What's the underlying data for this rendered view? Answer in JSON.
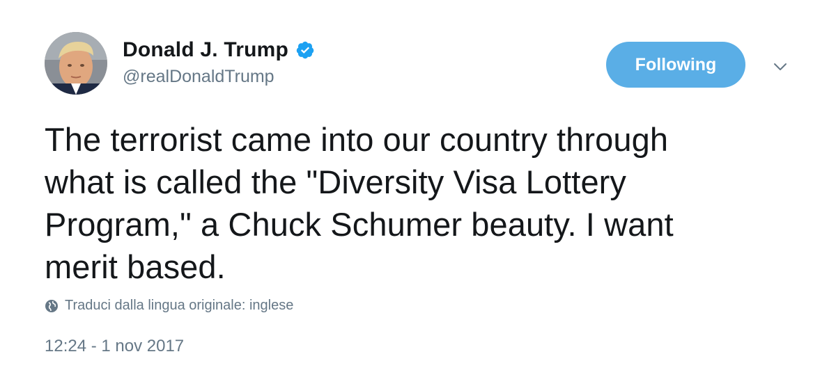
{
  "author": {
    "display_name": "Donald J. Trump",
    "handle": "@realDonaldTrump",
    "verified": true,
    "avatar_icon": "profile-photo"
  },
  "follow_button": {
    "label": "Following",
    "color": "#5aaee6"
  },
  "menu": {
    "icon": "chevron-down-icon"
  },
  "tweet": {
    "lines": [
      "The terrorist came into our country through",
      "what is called the \"Diversity Visa Lottery",
      "Program,\" a Chuck Schumer beauty. I want",
      "merit based."
    ]
  },
  "translate": {
    "icon": "globe-icon",
    "label": "Traduci dalla lingua originale: inglese"
  },
  "timestamp": "12:24 - 1 nov 2017",
  "colors": {
    "text": "#14171a",
    "secondary": "#657786",
    "accent": "#1da1f2"
  }
}
